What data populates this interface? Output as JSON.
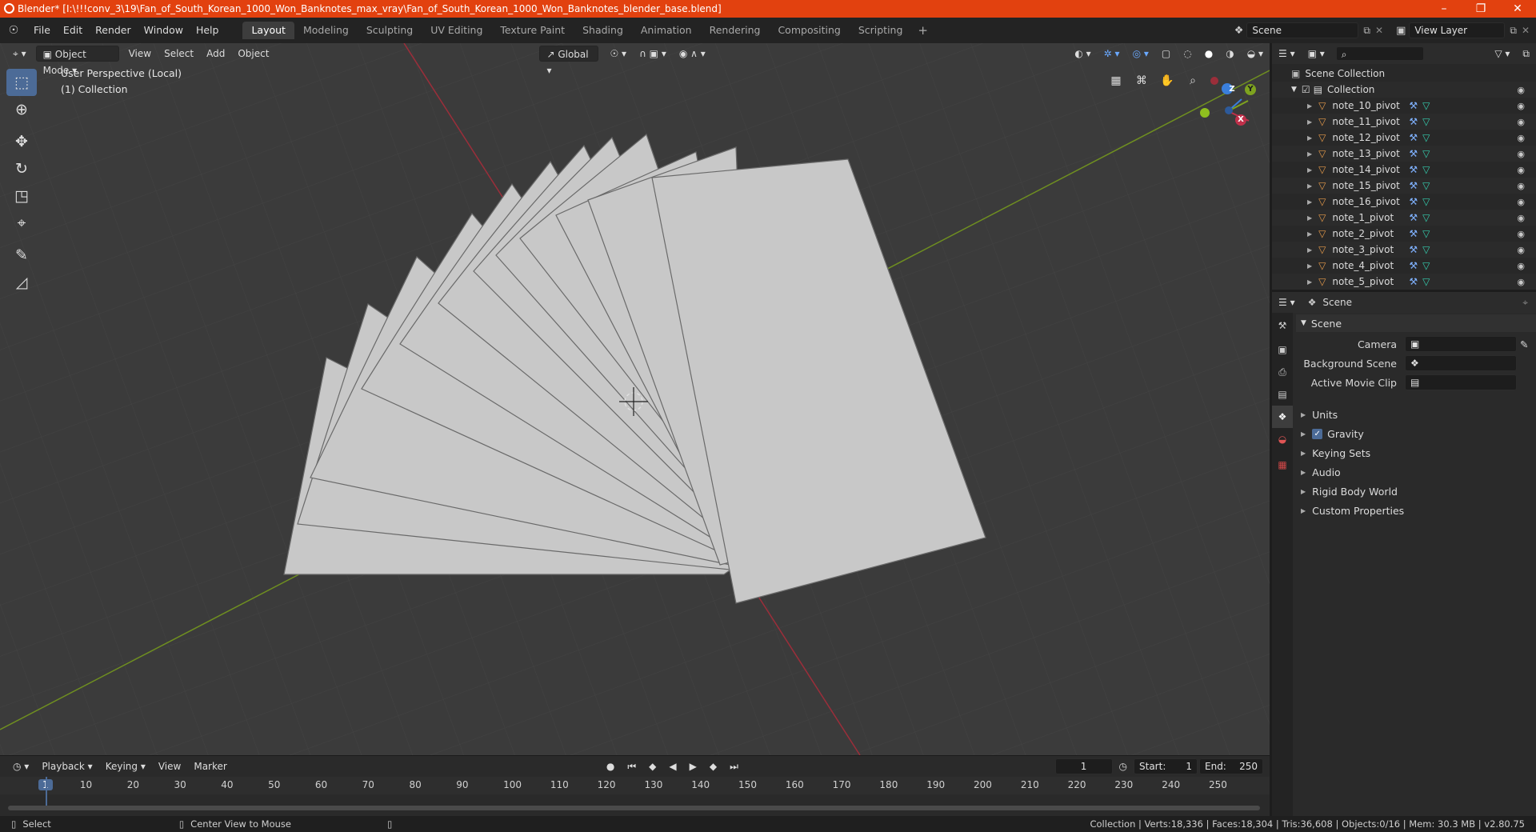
{
  "title": "Blender* [I:\\!!!conv_3\\19\\Fan_of_South_Korean_1000_Won_Banknotes_max_vray\\Fan_of_South_Korean_1000_Won_Banknotes_blender_base.blend]",
  "menus": [
    "File",
    "Edit",
    "Render",
    "Window",
    "Help"
  ],
  "workspaces": [
    "Layout",
    "Modeling",
    "Sculpting",
    "UV Editing",
    "Texture Paint",
    "Shading",
    "Animation",
    "Rendering",
    "Compositing",
    "Scripting"
  ],
  "scene_field": "Scene",
  "view_layer_field": "View Layer",
  "viewport": {
    "mode": "Object Mode",
    "menus": [
      "View",
      "Select",
      "Add",
      "Object"
    ],
    "transform": "Global",
    "perspective_label": "User Perspective (Local)",
    "collection_label": "(1) Collection",
    "gizmo": {
      "x": "X",
      "y": "Y",
      "z": "Z"
    }
  },
  "outliner": {
    "root": "Scene Collection",
    "collection": "Collection",
    "items": [
      "note_10_pivot",
      "note_11_pivot",
      "note_12_pivot",
      "note_13_pivot",
      "note_14_pivot",
      "note_15_pivot",
      "note_16_pivot",
      "note_1_pivot",
      "note_2_pivot",
      "note_3_pivot",
      "note_4_pivot",
      "note_5_pivot"
    ]
  },
  "properties": {
    "header": "Scene",
    "panel": "Scene",
    "camera_label": "Camera",
    "background_label": "Background Scene",
    "movieclip_label": "Active Movie Clip",
    "sections": [
      "Units",
      "Gravity",
      "Keying Sets",
      "Audio",
      "Rigid Body World",
      "Custom Properties"
    ]
  },
  "timeline": {
    "menus": [
      "Playback",
      "Keying",
      "View",
      "Marker"
    ],
    "current_frame": "1",
    "start_label": "Start:",
    "start": "1",
    "end_label": "End:",
    "end": "250",
    "ticks": [
      "1",
      "10",
      "20",
      "30",
      "40",
      "50",
      "60",
      "70",
      "80",
      "90",
      "100",
      "110",
      "120",
      "130",
      "140",
      "150",
      "160",
      "170",
      "180",
      "190",
      "200",
      "210",
      "220",
      "230",
      "240",
      "250"
    ]
  },
  "status": {
    "left": "Select",
    "middle": "Center View to Mouse",
    "right": "Collection | Verts:18,336 | Faces:18,304 | Tris:36,608 | Objects:0/16 | Mem: 30.3 MB | v2.80.75"
  },
  "colors": {
    "accent": "#e2410f",
    "active": "#4c6b97",
    "x_axis": "#c0304a",
    "y_axis": "#7ea31f",
    "z_axis": "#3a7fdc"
  }
}
